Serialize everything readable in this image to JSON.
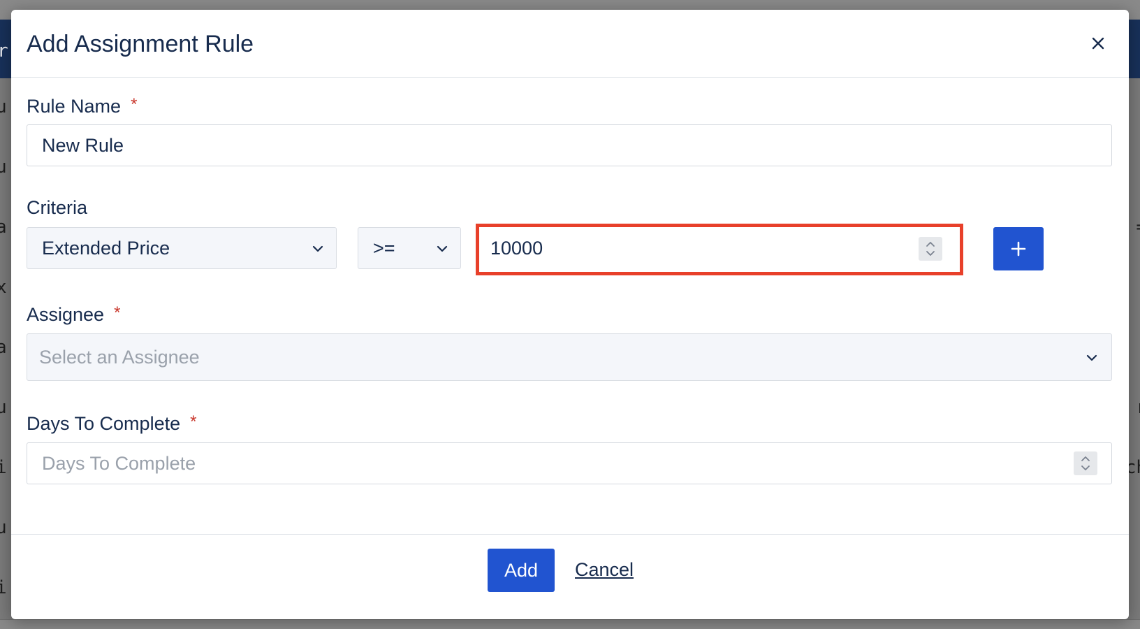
{
  "background": {
    "header_fragment": "rr",
    "rows": [
      {
        "left": "u",
        "right": ""
      },
      {
        "left": "u",
        "right": ""
      },
      {
        "left": "a",
        "right": "="
      },
      {
        "left": "x",
        "right": ""
      },
      {
        "left": "a",
        "right": ""
      },
      {
        "left": "u",
        "right": "r"
      },
      {
        "left": "i",
        "right": "ch"
      },
      {
        "left": "u",
        "right": ""
      },
      {
        "left": "i",
        "right": ""
      }
    ]
  },
  "modal": {
    "title": "Add Assignment Rule",
    "close_icon": "close-icon",
    "rule_name": {
      "label": "Rule Name",
      "required_mark": "*",
      "value": "New Rule"
    },
    "criteria": {
      "label": "Criteria",
      "field": {
        "selected": "Extended Price",
        "icon": "chevron-down-icon"
      },
      "operator": {
        "selected": ">=",
        "icon": "chevron-down-icon"
      },
      "value": "10000",
      "add_icon": "plus-icon",
      "highlight_color": "#e8402a"
    },
    "assignee": {
      "label": "Assignee",
      "required_mark": "*",
      "placeholder": "Select an Assignee"
    },
    "days_to_complete": {
      "label": "Days To Complete",
      "required_mark": "*",
      "placeholder": "Days To Complete"
    },
    "footer": {
      "add_label": "Add",
      "cancel_label": "Cancel"
    }
  },
  "colors": {
    "primary": "#2154d0",
    "text": "#172b4d",
    "required": "#c9372c",
    "header_bg": "#18315a"
  }
}
